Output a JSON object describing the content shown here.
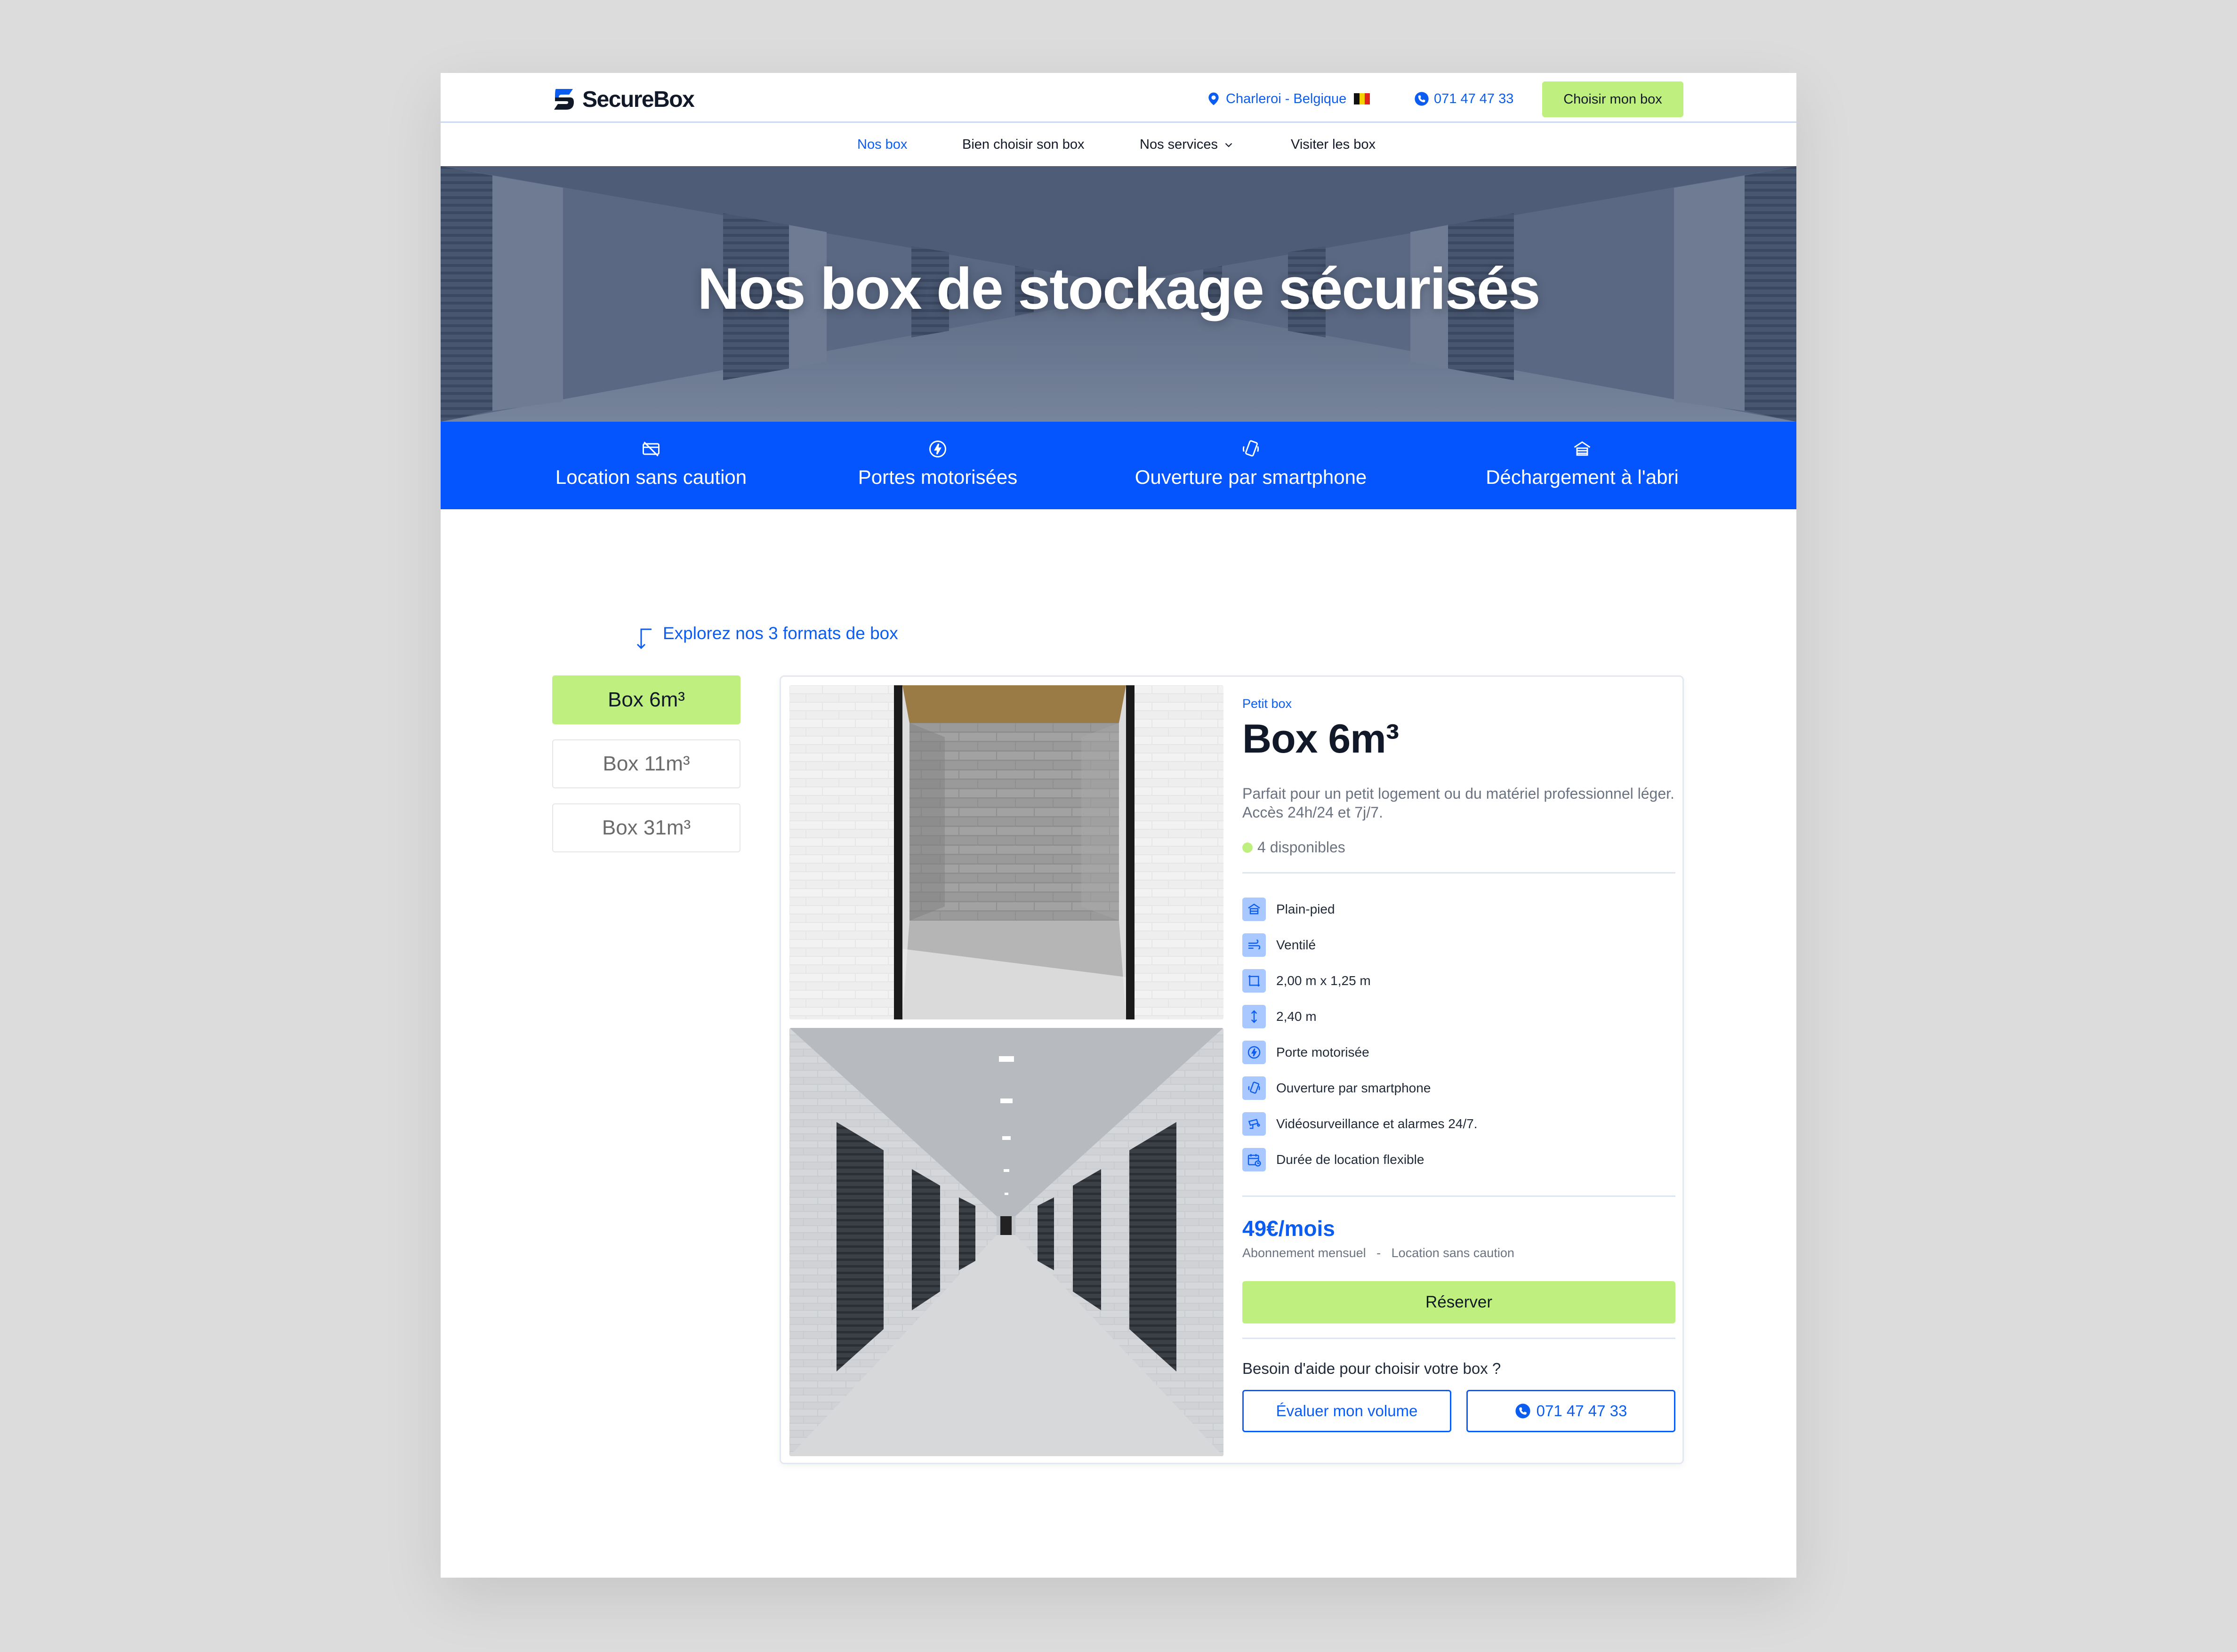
{
  "brand": {
    "name": "SecureBox"
  },
  "header": {
    "location": "Charleroi - Belgique",
    "phone": "071 47 47 33",
    "cta": "Choisir mon box"
  },
  "nav": {
    "items": [
      {
        "label": "Nos box",
        "active": true
      },
      {
        "label": "Bien choisir son box"
      },
      {
        "label": "Nos services"
      },
      {
        "label": "Visiter les box"
      }
    ]
  },
  "hero": {
    "title": "Nos box de stockage sécurisés"
  },
  "features": [
    {
      "label": "Location sans caution",
      "icon": "no-deposit-icon"
    },
    {
      "label": "Portes motorisées",
      "icon": "motor-icon"
    },
    {
      "label": "Ouverture par smartphone",
      "icon": "smartphone-icon"
    },
    {
      "label": "Déchargement à l'abri",
      "icon": "shelter-icon"
    }
  ],
  "explore": {
    "label": "Explorez nos 3 formats de box"
  },
  "tabs": [
    {
      "label": "Box 6m³",
      "active": true
    },
    {
      "label": "Box 11m³"
    },
    {
      "label": "Box 31m³"
    }
  ],
  "product": {
    "kicker": "Petit box",
    "title": "Box 6m³",
    "description": [
      "Parfait pour un petit logement ou du matériel professionnel léger.",
      "Accès 24h/24 et 7j/7."
    ],
    "availability": "4 disponibles",
    "features": [
      {
        "label": "Plain-pied",
        "icon": "ground-floor-icon"
      },
      {
        "label": "Ventilé",
        "icon": "ventilation-icon"
      },
      {
        "label": "2,00 m x 1,25 m",
        "icon": "surface-icon"
      },
      {
        "label": "2,40 m",
        "icon": "height-icon"
      },
      {
        "label": "Porte motorisée",
        "icon": "motor-icon"
      },
      {
        "label": "Ouverture par smartphone",
        "icon": "smartphone-icon"
      },
      {
        "label": "Vidéosurveillance et alarmes 24/7.",
        "icon": "camera-icon"
      },
      {
        "label": "Durée de location flexible",
        "icon": "calendar-icon"
      }
    ],
    "price": "49€/mois",
    "terms": "Abonnement mensuel   -   Location sans caution",
    "reserve": "Réserver",
    "help": "Besoin d'aide pour choisir votre box ?",
    "evaluate": "Évaluer mon volume",
    "phone": "071 47 47 33"
  },
  "colors": {
    "accent_blue": "#0555ff",
    "link_blue": "#0b5cf0",
    "lime": "#bff07f",
    "icon_tile": "#a8c8ff"
  }
}
